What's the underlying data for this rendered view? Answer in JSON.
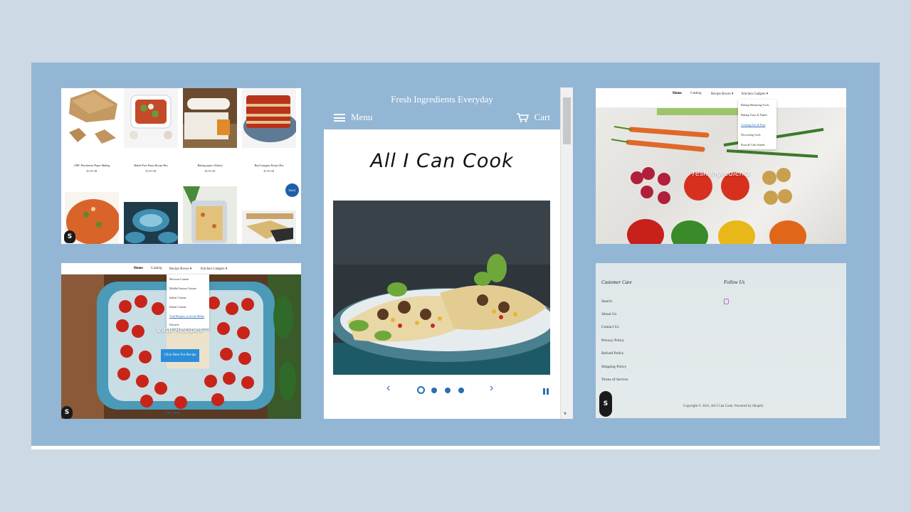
{
  "colors": {
    "accent": "#2a6fb0",
    "header_blue": "#93b6d4",
    "button_blue": "#2a8fd8",
    "page_bg": "#cdd9e5"
  },
  "grid_panel": {
    "products": [
      {
        "name": "10PC Parchment Paper Baking",
        "price": "$5.99 SR"
      },
      {
        "name": "Baked Feta Pasta Recipe Box",
        "price": "$5.99 SR"
      },
      {
        "name": "Baking paper (10mm)",
        "price": "$8.99 SR"
      },
      {
        "name": "Beef Lasagna Recipe Box",
        "price": "$5.99 SR"
      }
    ],
    "sale_badge": "SALE"
  },
  "recipe_panel": {
    "nav": {
      "home": "Home",
      "catalog": "Catalog",
      "recipe_boxes": "Recipe Boxes ▾",
      "kitchen_gadgets": "Kitchen Gadgets ▾"
    },
    "dropdown": [
      "Mexican Cuisine",
      "Middle Eastern Cuisine",
      "Italian Cuisine",
      "Indian Cuisine",
      "Viral Recipes on Social Media",
      "Desserts"
    ],
    "hero_text": "Viral Recipes",
    "cta": "Click Here For Recipe",
    "dots": "‹  ● ○ ● ●  ›"
  },
  "mobile_panel": {
    "tagline": "Fresh Ingredients Everyday",
    "menu_label": "Menu",
    "cart_label": "Cart",
    "title": "All I Can Cook",
    "prev": "‹",
    "next": "›",
    "scroll_down": "▾"
  },
  "gadgets_panel": {
    "nav": {
      "home": "Home",
      "catalog": "Catalog",
      "recipe_boxes": "Recipe Boxes ▾",
      "kitchen_gadgets": "Kitchen Gadgets ▾"
    },
    "dropdown": [
      "Baking Measuring Tools",
      "Baking Trays & Papers",
      "Cooking Pots & Pans",
      "Decorating Tools",
      "Pizza & Cake Stands"
    ],
    "hero_text": "Fresh Ingredients"
  },
  "footer_panel": {
    "customer_care": "Customer Care",
    "follow_us": "Follow Us",
    "links": [
      "Search",
      "About Us",
      "Contact Us",
      "Privacy Policy",
      "Refund Policy",
      "Shipping Policy",
      "Terms of Service"
    ],
    "copyright": "Copyright © 2021, All I Can Cook. Powered by Shopify"
  },
  "icons": {
    "shopify": "S",
    "cart": "cart-icon",
    "instagram": "instagram-icon"
  }
}
